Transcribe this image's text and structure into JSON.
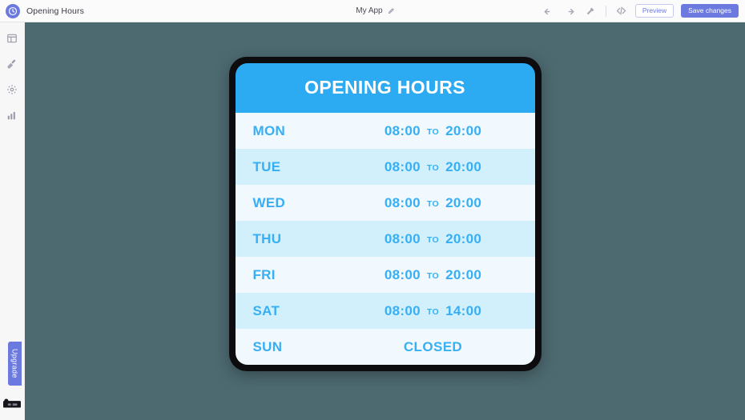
{
  "topbar": {
    "logo_icon": "clock-icon",
    "doc_title": "Opening Hours",
    "app_name": "My App",
    "edit_icon": "pencil-icon",
    "undo_icon": "undo-arrow-icon",
    "redo_icon": "redo-arrow-icon",
    "tools_icon": "hammer-icon",
    "code_icon": "code-brackets-icon",
    "code_label": "</>",
    "preview_label": "Preview",
    "save_label": "Save changes",
    "accent_color": "#6c7ae0"
  },
  "rail": {
    "items": [
      {
        "icon": "layout-grid-icon",
        "name": "sidebar-item-layout"
      },
      {
        "icon": "paintbrush-icon",
        "name": "sidebar-item-design"
      },
      {
        "icon": "gear-icon",
        "name": "sidebar-item-settings"
      },
      {
        "icon": "bar-chart-icon",
        "name": "sidebar-item-analytics"
      }
    ],
    "upgrade_label": "Upgrade",
    "bottom_logo_icon": "brand-logo-icon"
  },
  "card": {
    "title": "OPENING HOURS",
    "header_color": "#2cabf2",
    "text_color": "#37aff4",
    "row_odd_color": "#f1f8fe",
    "row_even_color": "#d2f0fb",
    "border_color": "#0d0d10",
    "separator_label": "TO",
    "closed_label": "CLOSED",
    "rows": [
      {
        "day": "MON",
        "open": "08:00",
        "close": "20:00",
        "closed": false
      },
      {
        "day": "TUE",
        "open": "08:00",
        "close": "20:00",
        "closed": false
      },
      {
        "day": "WED",
        "open": "08:00",
        "close": "20:00",
        "closed": false
      },
      {
        "day": "THU",
        "open": "08:00",
        "close": "20:00",
        "closed": false
      },
      {
        "day": "FRI",
        "open": "08:00",
        "close": "20:00",
        "closed": false
      },
      {
        "day": "SAT",
        "open": "08:00",
        "close": "14:00",
        "closed": false
      },
      {
        "day": "SUN",
        "open": "",
        "close": "",
        "closed": true
      }
    ]
  },
  "canvas": {
    "background_color": "#4d6a71"
  }
}
